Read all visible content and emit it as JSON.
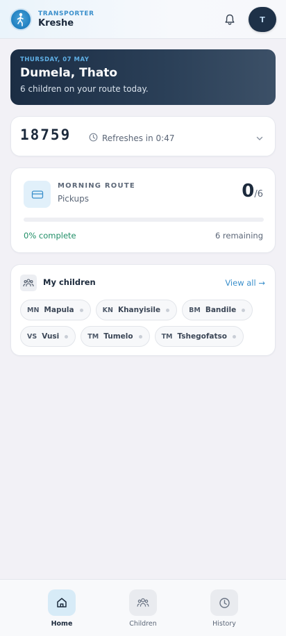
{
  "header": {
    "kicker": "TRANSPORTER",
    "name": "Kreshe",
    "avatar_initial": "T",
    "icons": {
      "logo": "runner-logo-icon",
      "notifications": "bell-icon"
    }
  },
  "greeting": {
    "date": "THURSDAY, 07 MAY",
    "title": "Dumela, Thato",
    "subtitle": "6 children on your route today."
  },
  "code_card": {
    "code": "18759",
    "refresh_text": "Refreshes in 0:47",
    "icons": {
      "clock": "clock-icon",
      "expand": "chevron-down-icon"
    }
  },
  "route": {
    "kicker": "MORNING ROUTE",
    "subtitle": "Pickups",
    "done": "0",
    "total": "/6",
    "progress_percent": 0,
    "progress_label": "0% complete",
    "remaining": "6 remaining",
    "icon": "ticket-icon"
  },
  "children": {
    "title": "My children",
    "view_all": "View all →",
    "icon": "people-icon",
    "items": [
      {
        "initials": "MN",
        "name": "Mapula"
      },
      {
        "initials": "KN",
        "name": "Khanyisile"
      },
      {
        "initials": "BM",
        "name": "Bandile"
      },
      {
        "initials": "VS",
        "name": "Vusi"
      },
      {
        "initials": "TM",
        "name": "Tumelo"
      },
      {
        "initials": "TM",
        "name": "Tshegofatso"
      }
    ]
  },
  "nav": {
    "items": [
      {
        "label": "Home",
        "icon": "home-icon",
        "active": true
      },
      {
        "label": "Children",
        "icon": "people-icon",
        "active": false
      },
      {
        "label": "History",
        "icon": "clock-icon",
        "active": false
      }
    ]
  },
  "colors": {
    "accent": "#3a8fcb",
    "progress": "#1f9d72",
    "greeting_bg": "#1b2d44"
  }
}
